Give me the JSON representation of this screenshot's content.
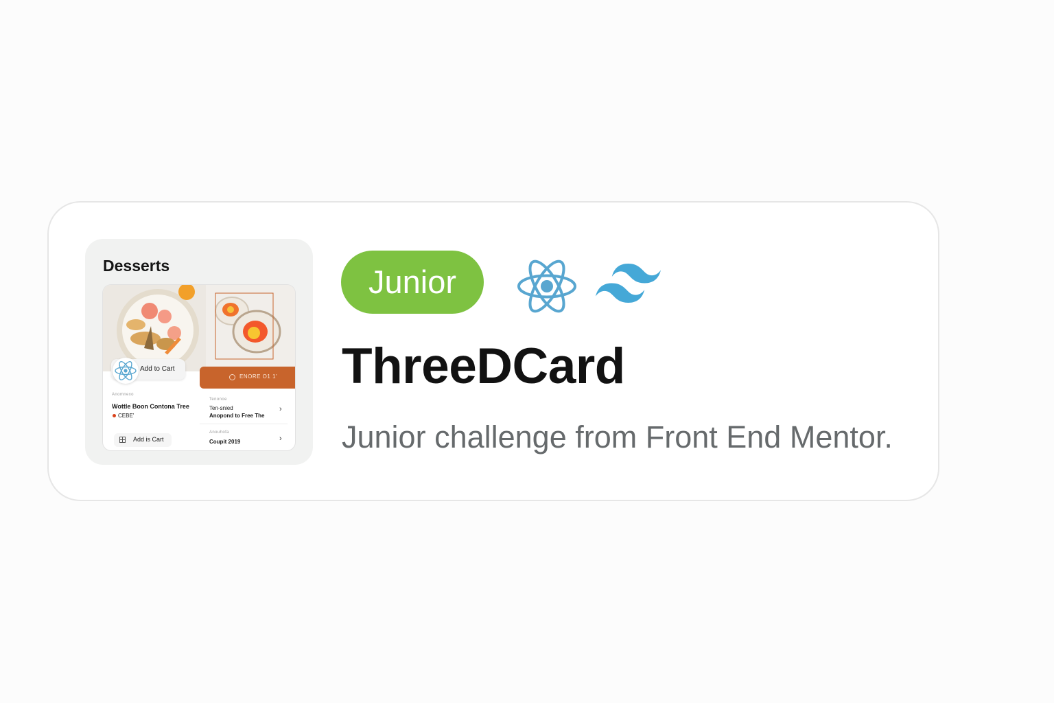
{
  "project": {
    "level_badge": "Junior",
    "title": "ThreeDCard",
    "description": "Junior challenge from Front End Mentor.",
    "tech_icons": [
      "react-icon",
      "tailwind-icon"
    ]
  },
  "thumbnail": {
    "heading": "Desserts",
    "add_to_cart_label": "Add to Cart",
    "orange_button_label": "ENORE O1 1'",
    "left_caption": "Anomnexo",
    "left_item_title": "Wottle Boon Contona Tree",
    "left_price": "CEBE'",
    "right_caption_1": "Tenonoe",
    "right_item_line1": "Ten-snied",
    "right_item_line2": "Anopond to Free The",
    "right_caption_2": "Anouhofa",
    "right_item_3": "Coupit 2019",
    "add_is_cart_label": "Add is Cart"
  },
  "colors": {
    "badge": "#7ec241",
    "react": "#58a6d0",
    "tailwind": "#45a8d7",
    "orange_accent": "#c8642c",
    "title": "#121212",
    "subtitle": "#666a6c"
  }
}
